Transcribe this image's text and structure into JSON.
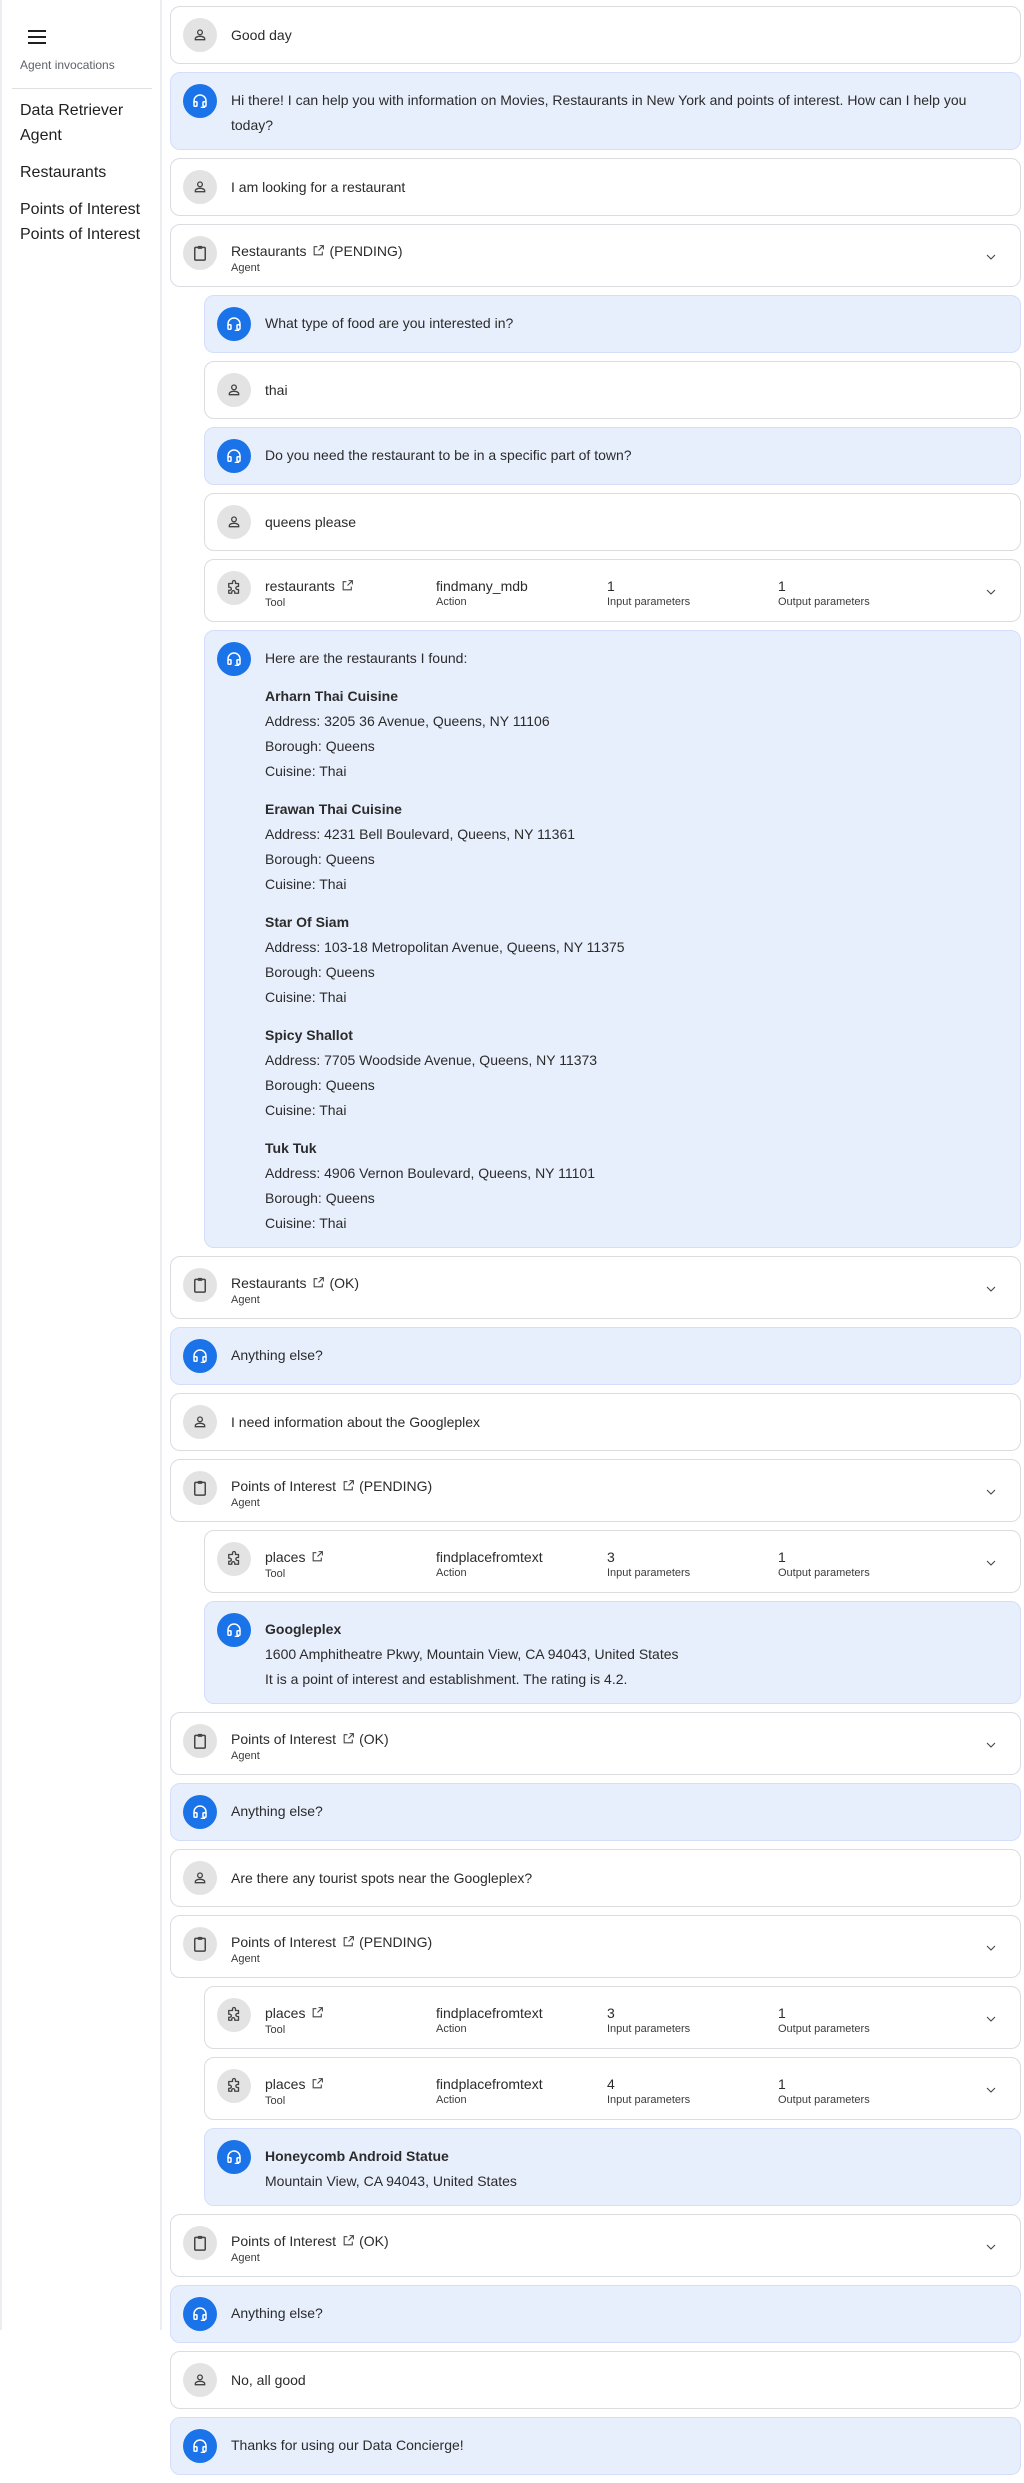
{
  "sidebar": {
    "caption": "Agent invocations",
    "items": [
      {
        "label": "Data Retriever Agent"
      },
      {
        "label": "Restaurants"
      },
      {
        "label": "Points of Interest"
      },
      {
        "label": "Points of Interest"
      }
    ]
  },
  "colors": {
    "accent": "#1a73e8",
    "bot_bg": "#e8effc",
    "card_border": "#dadce0"
  },
  "messages": [
    {
      "type": "user",
      "text": "Good day"
    },
    {
      "type": "bot",
      "text": "Hi there! I can help you with information on Movies, Restaurants in New York and points of interest. How can I help you today?"
    },
    {
      "type": "user",
      "text": "I am looking for a restaurant"
    },
    {
      "type": "agent",
      "name": "Restaurants",
      "status": "(PENDING)",
      "kind": "Agent"
    },
    {
      "type": "bot",
      "indent": true,
      "text": "What type of food are you interested in?"
    },
    {
      "type": "user",
      "indent": true,
      "text": "thai"
    },
    {
      "type": "bot",
      "indent": true,
      "text": "Do you need the restaurant to be in a specific part of town?"
    },
    {
      "type": "user",
      "indent": true,
      "text": "queens please"
    },
    {
      "type": "tool",
      "indent": true,
      "name": "restaurants",
      "kind": "Tool",
      "action": "findmany_mdb",
      "action_label": "Action",
      "inputs": "1",
      "inputs_label": "Input parameters",
      "outputs": "1",
      "outputs_label": "Output parameters"
    },
    {
      "type": "bot-list",
      "indent": true,
      "intro": "Here are the restaurants I found:",
      "restaurants": [
        {
          "name": "Arharn Thai Cuisine",
          "address": "Address: 3205 36 Avenue, Queens, NY 11106",
          "borough": "Borough: Queens",
          "cuisine": "Cuisine: Thai"
        },
        {
          "name": "Erawan Thai Cuisine",
          "address": "Address: 4231 Bell Boulevard, Queens, NY 11361",
          "borough": "Borough: Queens",
          "cuisine": "Cuisine: Thai"
        },
        {
          "name": "Star Of Siam",
          "address": "Address: 103-18 Metropolitan Avenue, Queens, NY 11375",
          "borough": "Borough: Queens",
          "cuisine": "Cuisine: Thai"
        },
        {
          "name": "Spicy Shallot",
          "address": "Address: 7705 Woodside Avenue, Queens, NY 11373",
          "borough": "Borough: Queens",
          "cuisine": "Cuisine: Thai"
        },
        {
          "name": "Tuk Tuk",
          "address": "Address: 4906 Vernon Boulevard, Queens, NY 11101",
          "borough": "Borough: Queens",
          "cuisine": "Cuisine: Thai"
        }
      ]
    },
    {
      "type": "agent",
      "name": "Restaurants",
      "status": "(OK)",
      "kind": "Agent"
    },
    {
      "type": "bot",
      "text": "Anything else?"
    },
    {
      "type": "user",
      "text": "I need information about the Googleplex"
    },
    {
      "type": "agent",
      "name": "Points of Interest",
      "status": "(PENDING)",
      "kind": "Agent"
    },
    {
      "type": "tool",
      "indent": true,
      "name": "places",
      "kind": "Tool",
      "action": "findplacefromtext",
      "action_label": "Action",
      "inputs": "3",
      "inputs_label": "Input parameters",
      "outputs": "1",
      "outputs_label": "Output parameters"
    },
    {
      "type": "bot-place",
      "indent": true,
      "title": "Googleplex",
      "lines": [
        "1600 Amphitheatre Pkwy, Mountain View, CA 94043, United States",
        "It is a point of interest and establishment. The rating is 4.2."
      ]
    },
    {
      "type": "agent",
      "name": "Points of Interest",
      "status": "(OK)",
      "kind": "Agent"
    },
    {
      "type": "bot",
      "text": "Anything else?"
    },
    {
      "type": "user",
      "text": "Are there any tourist spots near the Googleplex?"
    },
    {
      "type": "agent",
      "name": "Points of Interest",
      "status": "(PENDING)",
      "kind": "Agent"
    },
    {
      "type": "tool",
      "indent": true,
      "name": "places",
      "kind": "Tool",
      "action": "findplacefromtext",
      "action_label": "Action",
      "inputs": "3",
      "inputs_label": "Input parameters",
      "outputs": "1",
      "outputs_label": "Output parameters"
    },
    {
      "type": "tool",
      "indent": true,
      "name": "places",
      "kind": "Tool",
      "action": "findplacefromtext",
      "action_label": "Action",
      "inputs": "4",
      "inputs_label": "Input parameters",
      "outputs": "1",
      "outputs_label": "Output parameters"
    },
    {
      "type": "bot-place",
      "indent": true,
      "title": "Honeycomb Android Statue",
      "lines": [
        "Mountain View, CA 94043, United States"
      ]
    },
    {
      "type": "agent",
      "name": "Points of Interest",
      "status": "(OK)",
      "kind": "Agent"
    },
    {
      "type": "bot",
      "text": "Anything else?"
    },
    {
      "type": "user",
      "text": "No, all good"
    },
    {
      "type": "bot",
      "text": "Thanks for using our Data Concierge!"
    }
  ]
}
